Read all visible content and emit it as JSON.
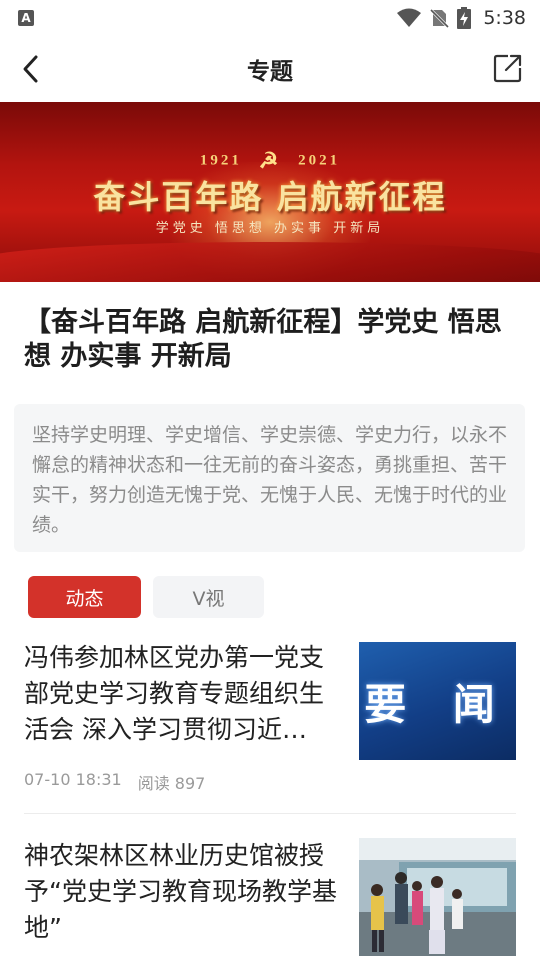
{
  "status_bar": {
    "time": "5:38",
    "app_badge": "A"
  },
  "nav": {
    "title": "专题"
  },
  "banner": {
    "year_left": "1921",
    "year_right": "2021",
    "slogan": "奋斗百年路 启航新征程",
    "subline": "学党史 悟思想 办实事 开新局"
  },
  "topic": {
    "title": "【奋斗百年路 启航新征程】学党史 悟思想 办实事 开新局",
    "description": "坚持学史明理、学史增信、学史崇德、学史力行，以永不懈怠的精神状态和一往无前的奋斗姿态，勇挑重担、苦干实干，努力创造无愧于党、无愧于人民、无愧于时代的业绩。"
  },
  "tabs": [
    {
      "label": "动态",
      "active": true
    },
    {
      "label": "V视",
      "active": false
    }
  ],
  "news": [
    {
      "title": "冯伟参加林区党办第一党支部党史学习教育专题组织生活会  深入学习贯彻习近…",
      "time": "07-10 18:31",
      "reads": "阅读 897",
      "thumb_text": "要 闻"
    },
    {
      "title": "神农架林区林业历史馆被授予“党史学习教育现场教学基地”"
    }
  ],
  "colors": {
    "accent": "#d3322a",
    "text_muted": "#8b8b8b"
  }
}
